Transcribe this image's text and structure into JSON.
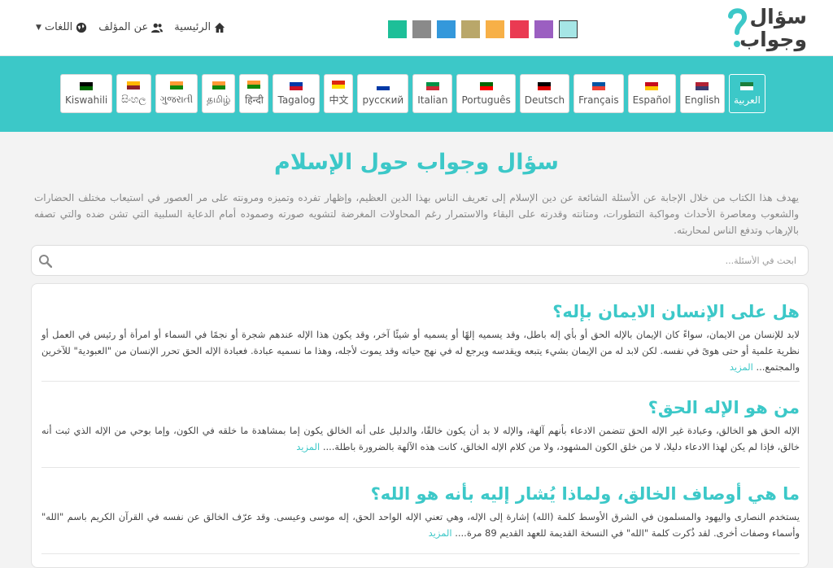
{
  "logo": {
    "line1": "سؤال",
    "line2": "وجواب"
  },
  "theme_swatches": [
    {
      "color": "#1dbf98"
    },
    {
      "color": "#8a8a8a"
    },
    {
      "color": "#3498db"
    },
    {
      "color": "#b9a76a"
    },
    {
      "color": "#f7b047"
    },
    {
      "color": "#ea3a52"
    },
    {
      "color": "#9b5fc1"
    },
    {
      "color": "#a6e6e6",
      "active": true
    }
  ],
  "topnav": {
    "home": "الرئيسية",
    "about": "عن المؤلف",
    "languages": "اللغات"
  },
  "languages": [
    {
      "label": "العربية",
      "active": true
    },
    {
      "label": "English"
    },
    {
      "label": "Español"
    },
    {
      "label": "Français"
    },
    {
      "label": "Deutsch"
    },
    {
      "label": "Português"
    },
    {
      "label": "Italian"
    },
    {
      "label": "русский"
    },
    {
      "label": "中文"
    },
    {
      "label": "Tagalog"
    },
    {
      "label": "हिन्दी"
    },
    {
      "label": "தமிழ்"
    },
    {
      "label": "ગુજરાતી"
    },
    {
      "label": "සිංහල"
    },
    {
      "label": "Kiswahili"
    }
  ],
  "main": {
    "title": "سؤال وجواب حول الإسلام",
    "intro": "يهدف هذا الكتاب من خلال الإجابة عن الأسئلة الشائعة عن دين الإسلام إلى تعريف الناس بهذا الدين العظيم، وإظهار تفرده وتميزه ومرونته على مر العصور في استيعاب مختلف الحضارات والشعوب ومعاصرة الأحداث ومواكبة التطورات، ومتانته وقدرته على البقاء والاستمرار رغم المحاولات المغرضة لتشويه صورته وصموده أمام الدعاية السلبية التي تشن ضده والتي تصفه بالإرهاب وتدفع الناس لمحاربته.",
    "search_placeholder": "ابحث في الأسئلة..."
  },
  "questions": [
    {
      "title": "هل على الإنسان الايمان بإله؟",
      "excerpt": "لابد للإنسان من الايمان، سواءً كان الإيمان بالإله الحق أو بأي إله باطل، وقد يسميه إلهًا أو يسميه أو شيئًا آخر، وقد يكون هذا الإله عندهم شجرة أو نجمًا في السماء أو امرأة أو رئيس في العمل أو نظرية علمية أو حتى هوىً في نفسه. لكن لابد له من الإيمان بشيء يتبعه ويقدسه ويرجع له في نهج حياته وقد يموت لأجله، وهذا ما نسميه عبادة. فعبادة الإله الحق تحرر الإنسان من \"العبودية\" للآخرين والمجتمع...",
      "more": "المزيد"
    },
    {
      "title": "من هو الإله الحق؟",
      "excerpt": "الإله الحق هو الخالق، وعبادة غير الإله الحق تتضمن الادعاء بأنهم آلهة، والإله لا بد أن يكون خالقًا، والدليل على أنه الخالق يكون إما بمشاهدة ما خلقه في الكون، وإما بوحي من الإله الذي ثبت أنه خالق، فإذا لم يكن لهذا الادعاء دليلا، لا من خلق الكون المشهود، ولا من كلام الإله الخالق، كانت هذه الآلهة بالضرورة باطلة....",
      "more": "المزيد"
    },
    {
      "title": "ما هي أوصاف الخالق، ولماذا يُشار إليه بأنه هو الله؟",
      "excerpt": "يستخدم النصارى واليهود والمسلمون في الشرق الأوسط كلمة (الله) إشارة إلى الإله، وهي تعني الإله الواحد الحق، إله موسى وعيسى. وقد عرّف الخالق عن نفسه في القرآن الكريم باسم \"الله\" وأسماء وصفات أخرى. لقد ذُكرت كلمة \"الله\" في النسخة القديمة للعهد القديم 89 مرة....",
      "more": "المزيد"
    }
  ]
}
